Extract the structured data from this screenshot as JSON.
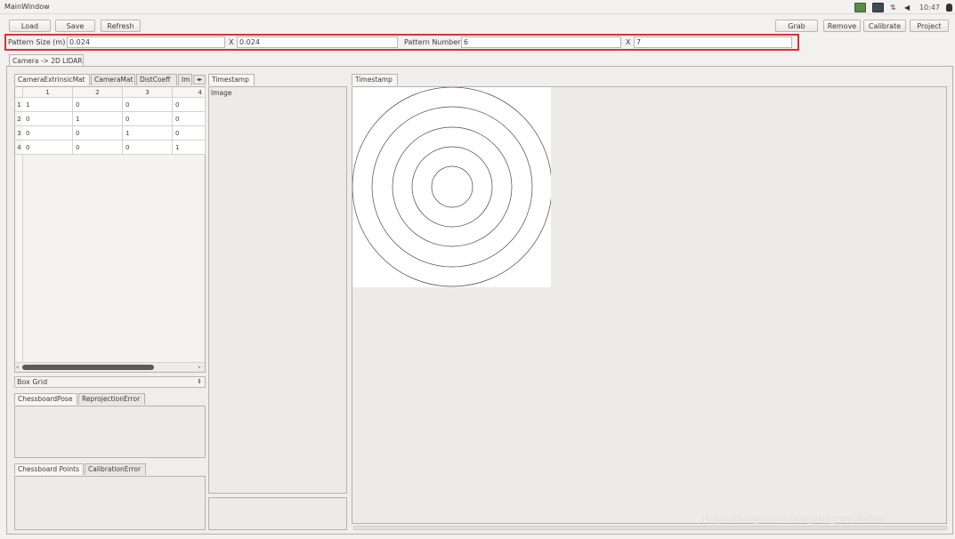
{
  "window": {
    "title": "MainWindow"
  },
  "tray": {
    "time": "10:47",
    "icons": [
      "monitor-icon",
      "keyboard-icon",
      "network-icon",
      "volume-icon",
      "power-icon"
    ]
  },
  "toolbar": {
    "load": "Load",
    "save": "Save",
    "refresh": "Refresh",
    "grab": "Grab",
    "remove": "Remove",
    "calibrate": "Calibrate",
    "project": "Project"
  },
  "pattern": {
    "size_label": "Pattern Size (m)",
    "size_x": "0.024",
    "x_sep_1": "X",
    "size_y": "0.024",
    "number_label": "Pattern Number",
    "number_x": "6",
    "x_sep_2": "X",
    "number_y": "7",
    "highlight_color": "#e03030"
  },
  "main_tab": "Camera -> 2D LIDAR",
  "matrix_tabs": [
    "CameraExtrinsicMat",
    "CameraMat",
    "DistCoeff",
    "Im"
  ],
  "matrix": {
    "columns": [
      "1",
      "2",
      "3",
      "4"
    ],
    "rows": [
      {
        "header": "1",
        "cells": [
          "1",
          "0",
          "0",
          "0"
        ]
      },
      {
        "header": "2",
        "cells": [
          "0",
          "1",
          "0",
          "0"
        ]
      },
      {
        "header": "3",
        "cells": [
          "0",
          "0",
          "1",
          "0"
        ]
      },
      {
        "header": "4",
        "cells": [
          "0",
          "0",
          "0",
          "1"
        ]
      }
    ]
  },
  "grid_select": "Box Grid",
  "pose_tabs": [
    "ChessboardPose",
    "ReprojectionError"
  ],
  "points_tabs": [
    "Chessboard Points",
    "CalibrationError"
  ],
  "middle_tab": "Timestamp",
  "middle_content": "Image",
  "right_tab": "Timestamp",
  "watermark": "https://blog.csdn.net/yourgreatfather"
}
